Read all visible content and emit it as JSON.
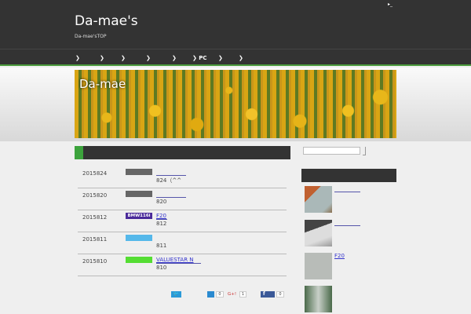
{
  "header": {
    "title": "Da-mae's",
    "description": "Da-mae'sTOP",
    "top_link": "▸_"
  },
  "nav": {
    "items": [
      "❯",
      "❯",
      "❯",
      "❯",
      "❯",
      "❯ PC",
      "❯",
      "❯"
    ]
  },
  "banner": {
    "title": "Da-mae"
  },
  "posts": [
    {
      "date": "2015824",
      "category": "",
      "category_color": "#666666",
      "link": "",
      "sub": "824（^^"
    },
    {
      "date": "2015820",
      "category": "",
      "category_color": "#666666",
      "link": "",
      "sub": "820"
    },
    {
      "date": "2015812",
      "category": "BMW116i",
      "category_color": "#4a2a9a",
      "link": "F20",
      "sub": "812"
    },
    {
      "date": "2015811",
      "category": "",
      "category_color": "#55b8ea",
      "link": "",
      "sub": "811"
    },
    {
      "date": "2015810",
      "category": "",
      "category_color": "#55dd33",
      "link": "VALUESTAR N",
      "sub": "810"
    }
  ],
  "share": {
    "hatena_count": "0",
    "gplus_label": "G+!",
    "gplus_count": "1",
    "facebook_count": "0"
  },
  "sidebar": {
    "search_placeholder": "",
    "recent": [
      {
        "title": ""
      },
      {
        "title": ""
      },
      {
        "title": "F20"
      },
      {
        "title": ""
      }
    ]
  }
}
